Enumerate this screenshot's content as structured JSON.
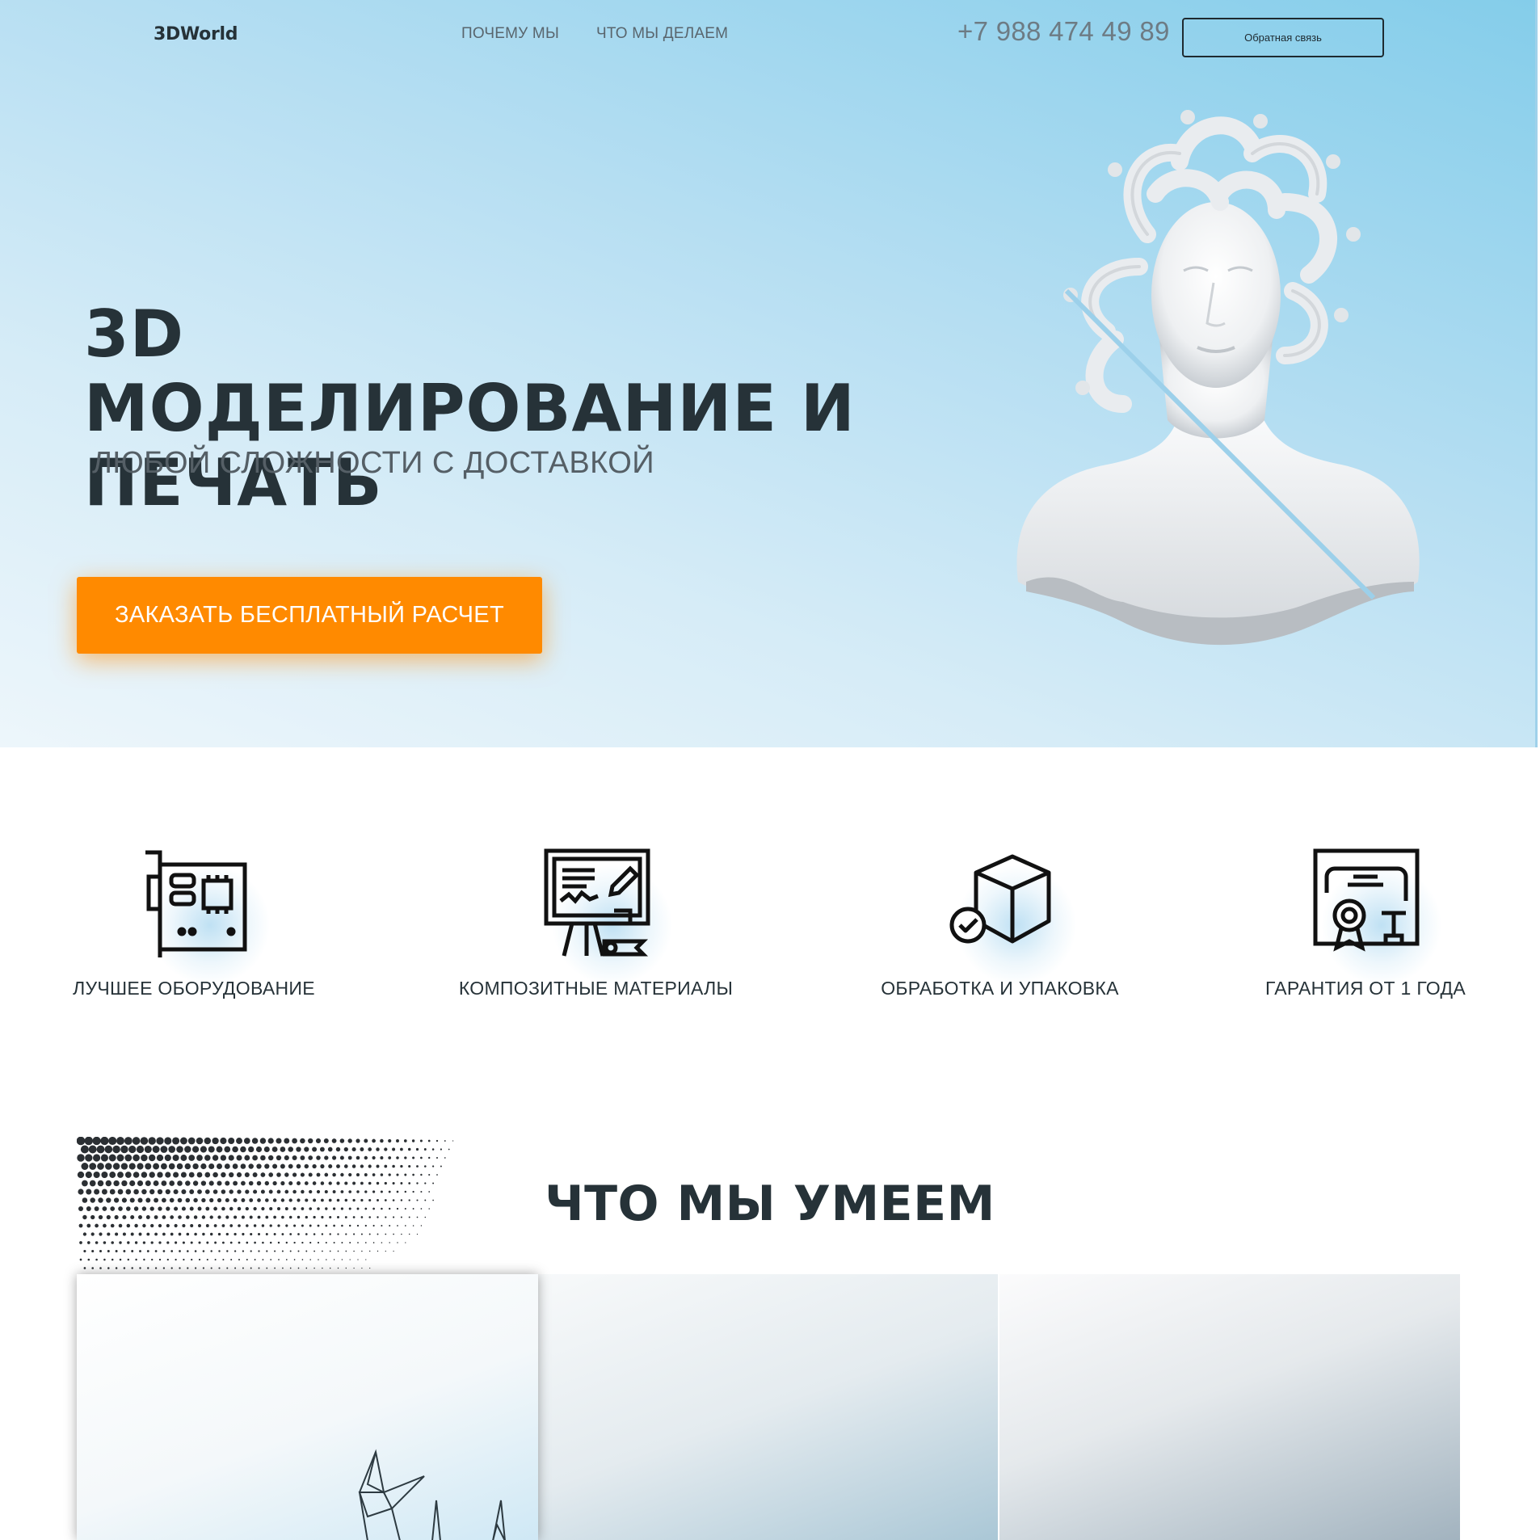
{
  "header": {
    "logo": "3DWorld",
    "nav": [
      {
        "label": "ПОЧЕМУ МЫ"
      },
      {
        "label": "ЧТО МЫ ДЕЛАЕМ"
      }
    ],
    "phone": "+7 988 474 49 89",
    "feedback_label": "Обратная связь"
  },
  "hero": {
    "title_line1": "3D МОДЕЛИРОВАНИЕ И",
    "title_line2": "ПЕЧАТЬ",
    "subtitle": "ЛЮБОЙ СЛОЖНОСТИ С ДОСТАВКОЙ",
    "cta_label": "ЗАКАЗАТЬ БЕСПЛАТНЫЙ РАСЧЕТ",
    "image_icon": "medusa-bust-image"
  },
  "features": [
    {
      "label": "ЛУЧШЕЕ ОБОРУДОВАНИЕ",
      "icon": "circuit-board-icon"
    },
    {
      "label": "КОМПОЗИТНЫЕ МАТЕРИАЛЫ",
      "icon": "presentation-board-icon"
    },
    {
      "label": "ОБРАБОТКА И УПАКОВКА",
      "icon": "package-check-icon"
    },
    {
      "label": "ГАРАНТИЯ ОТ 1 ГОДА",
      "icon": "certificate-icon"
    }
  ],
  "services": {
    "title": "ЧТО МЫ УМЕЕМ"
  },
  "colors": {
    "accent": "#ff8a00",
    "text_dark": "#263238",
    "hero_blue": "#84cdea"
  }
}
